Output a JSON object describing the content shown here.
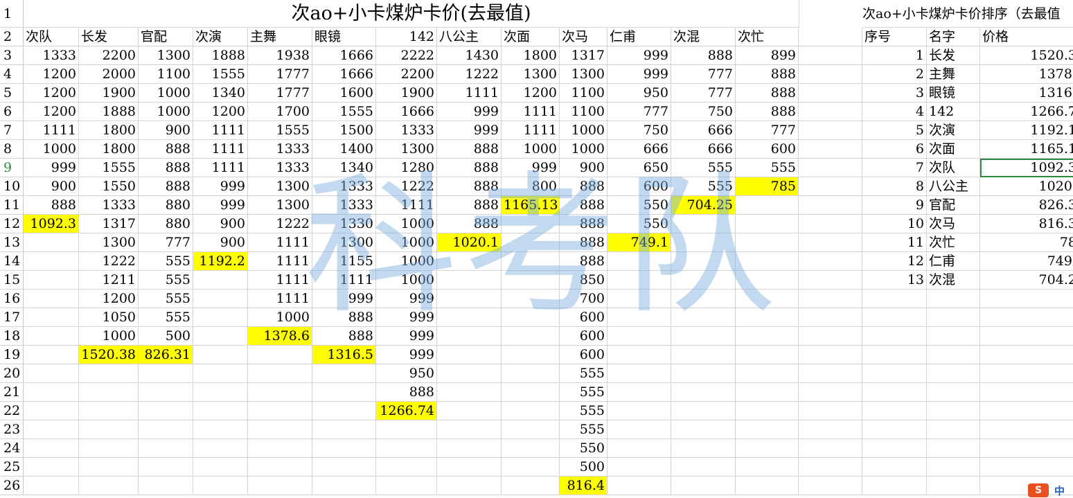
{
  "sheet": {
    "title_main": "次ao+小卡煤炉卡价(去最值)",
    "title_rank": "次ao+小卡煤炉卡价排序（去最值",
    "row_numbers": [
      "1",
      "2",
      "3",
      "4",
      "5",
      "6",
      "7",
      "8",
      "9",
      "10",
      "11",
      "12",
      "13",
      "14",
      "15",
      "16",
      "17",
      "18",
      "19",
      "20",
      "21",
      "22",
      "23",
      "24",
      "25",
      "26"
    ],
    "active_row": "9",
    "columns": [
      {
        "header": "次队",
        "values": [
          "1333",
          "1200",
          "1200",
          "1200",
          "1111",
          "1000",
          "999",
          "900",
          "888",
          "1092.3"
        ],
        "avg_row": 12
      },
      {
        "header": "长发",
        "values": [
          "2200",
          "2000",
          "1900",
          "1888",
          "1800",
          "1800",
          "1555",
          "1550",
          "1333",
          "1317",
          "1300",
          "1222",
          "1211",
          "1200",
          "1050",
          "1000",
          "1520.38"
        ],
        "avg_row": 19
      },
      {
        "header": "官配",
        "values": [
          "1300",
          "1100",
          "1000",
          "1000",
          "900",
          "888",
          "888",
          "888",
          "880",
          "880",
          "777",
          "555",
          "555",
          "555",
          "555",
          "500",
          "826.31"
        ],
        "avg_row": 19
      },
      {
        "header": "次演",
        "values": [
          "1888",
          "1555",
          "1340",
          "1200",
          "1111",
          "1111",
          "1111",
          "999",
          "999",
          "900",
          "900",
          "1192.2"
        ],
        "avg_row": 14
      },
      {
        "header": "主舞",
        "values": [
          "1938",
          "1777",
          "1777",
          "1700",
          "1555",
          "1333",
          "1333",
          "1300",
          "1300",
          "1222",
          "1111",
          "1111",
          "1111",
          "1111",
          "1000",
          "1378.6"
        ],
        "avg_row": 18
      },
      {
        "header": "眼镜",
        "values": [
          "1666",
          "1666",
          "1600",
          "1555",
          "1500",
          "1400",
          "1340",
          "1333",
          "1333",
          "1330",
          "1300",
          "1155",
          "1111",
          "999",
          "888",
          "888",
          "1316.5"
        ],
        "avg_row": 19
      },
      {
        "header": "142",
        "values": [
          "2222",
          "2200",
          "1900",
          "1666",
          "1333",
          "1300",
          "1280",
          "1222",
          "1111",
          "1000",
          "1000",
          "1000",
          "1000",
          "999",
          "999",
          "999",
          "999",
          "950",
          "888",
          "1266.74"
        ],
        "avg_row": 22
      },
      {
        "header": "八公主",
        "values": [
          "1430",
          "1222",
          "1111",
          "999",
          "999",
          "888",
          "888",
          "888",
          "888",
          "888",
          "1020.1"
        ],
        "avg_row": 13
      },
      {
        "header": "次面",
        "values": [
          "1800",
          "1300",
          "1200",
          "1111",
          "1111",
          "1000",
          "999",
          "800",
          "1165.13"
        ],
        "avg_row": 11
      },
      {
        "header": "次马",
        "values": [
          "1317",
          "1300",
          "1100",
          "1100",
          "1000",
          "1000",
          "900",
          "888",
          "888",
          "888",
          "888",
          "888",
          "850",
          "700",
          "600",
          "600",
          "600",
          "555",
          "555",
          "555",
          "555",
          "550",
          "500",
          "816.4"
        ],
        "avg_row": 26
      },
      {
        "header": "仁甫",
        "values": [
          "999",
          "999",
          "950",
          "777",
          "750",
          "666",
          "650",
          "600",
          "550",
          "550",
          "749.1"
        ],
        "avg_row": 13
      },
      {
        "header": "次混",
        "values": [
          "888",
          "777",
          "777",
          "750",
          "666",
          "666",
          "555",
          "555",
          "704.25"
        ],
        "avg_row": 11
      },
      {
        "header": "次忙",
        "values": [
          "899",
          "888",
          "888",
          "888",
          "777",
          "600",
          "555",
          "785"
        ],
        "avg_row": 10
      }
    ],
    "ranking": {
      "headers": {
        "seq": "序号",
        "name": "名字",
        "price": "价格"
      },
      "rows": [
        {
          "seq": "1",
          "name": "长发",
          "price": "1520.3"
        },
        {
          "seq": "2",
          "name": "主舞",
          "price": "1378."
        },
        {
          "seq": "3",
          "name": "眼镜",
          "price": "1316."
        },
        {
          "seq": "4",
          "name": "142",
          "price": "1266.7"
        },
        {
          "seq": "5",
          "name": "次演",
          "price": "1192.1"
        },
        {
          "seq": "6",
          "name": "次面",
          "price": "1165.1"
        },
        {
          "seq": "7",
          "name": "次队",
          "price": "1092.3"
        },
        {
          "seq": "8",
          "name": "八公主",
          "price": "1020."
        },
        {
          "seq": "9",
          "name": "官配",
          "price": "826.3"
        },
        {
          "seq": "10",
          "name": "次马",
          "price": "816.3"
        },
        {
          "seq": "11",
          "name": "次忙",
          "price": "78"
        },
        {
          "seq": "12",
          "name": "仁甫",
          "price": "749."
        },
        {
          "seq": "13",
          "name": "次混",
          "price": "704.2"
        }
      ],
      "selected_row": 7
    },
    "watermark": "科考队",
    "highlight_color": "#ffff00",
    "selection_color": "#2e8b3a"
  },
  "ime": {
    "logo": "S",
    "lang": "中"
  }
}
